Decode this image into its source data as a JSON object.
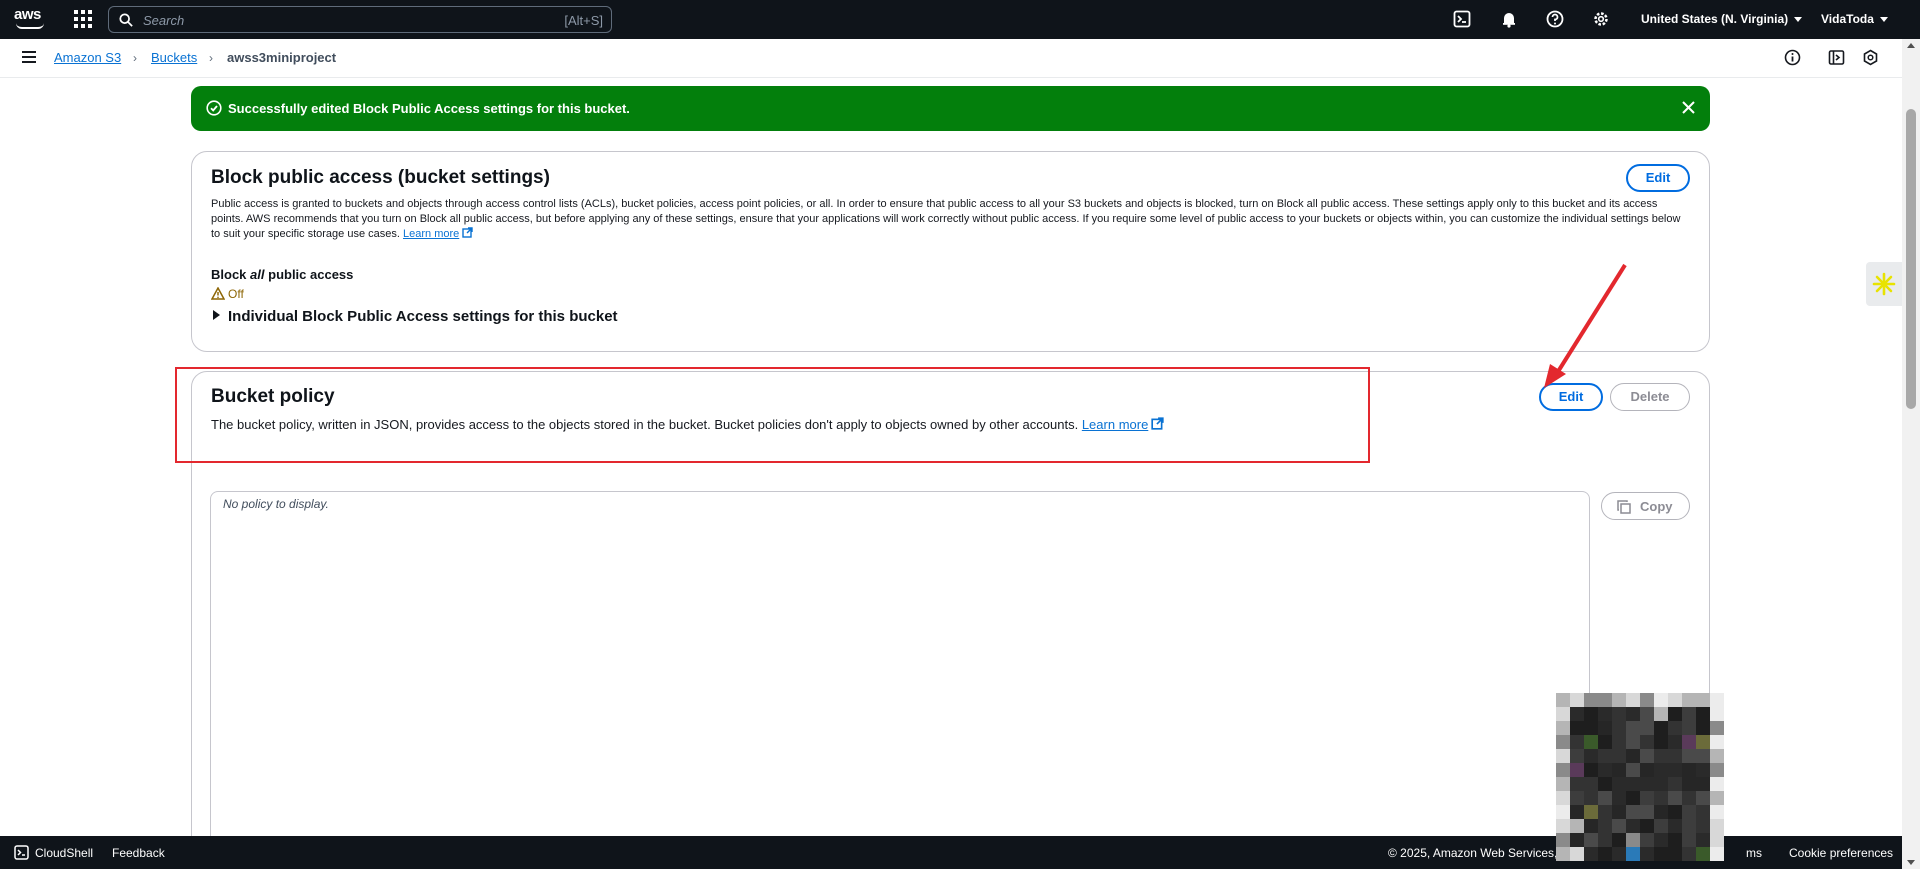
{
  "topnav": {
    "logo_text": "aws",
    "search_placeholder": "Search",
    "search_shortcut": "[Alt+S]",
    "region": "United States (N. Virginia)",
    "user": "VidaToda",
    "icons": [
      "cloudshell-icon",
      "bell-icon",
      "help-icon",
      "gear-icon"
    ]
  },
  "breadcrumb": {
    "items": [
      "Amazon S3",
      "Buckets"
    ],
    "current": "awss3miniproject"
  },
  "flash": {
    "message": "Successfully edited Block Public Access settings for this bucket.",
    "color": "#037f0c"
  },
  "block_public_access": {
    "title": "Block public access (bucket settings)",
    "edit_label": "Edit",
    "description": "Public access is granted to buckets and objects through access control lists (ACLs), bucket policies, access point policies, or all. In order to ensure that public access to all your S3 buckets and objects is blocked, turn on Block all public access. These settings apply only to this bucket and its access points. AWS recommends that you turn on Block all public access, but before applying any of these settings, ensure that your applications will work correctly without public access. If you require some level of public access to your buckets or objects within, you can customize the individual settings below to suit your specific storage use cases.",
    "learn_more": "Learn more",
    "block_all_prefix": "Block",
    "block_all_emph": "all",
    "block_all_suffix": "public access",
    "status": "Off",
    "expander_label": "Individual Block Public Access settings for this bucket"
  },
  "bucket_policy": {
    "title": "Bucket policy",
    "edit_label": "Edit",
    "delete_label": "Delete",
    "description": "The bucket policy, written in JSON, provides access to the objects stored in the bucket. Bucket policies don't apply to objects owned by other accounts.",
    "learn_more": "Learn more",
    "empty_text": "No policy to display.",
    "copy_label": "Copy"
  },
  "footer": {
    "cloudshell": "CloudShell",
    "feedback": "Feedback",
    "copyright": "© 2025, Amazon Web Services, I",
    "terms_fragment": "ms",
    "cookie": "Cookie preferences"
  },
  "colors": {
    "accent": "#006ce0",
    "annotation": "#e3282e",
    "warning": "#8d6605"
  }
}
